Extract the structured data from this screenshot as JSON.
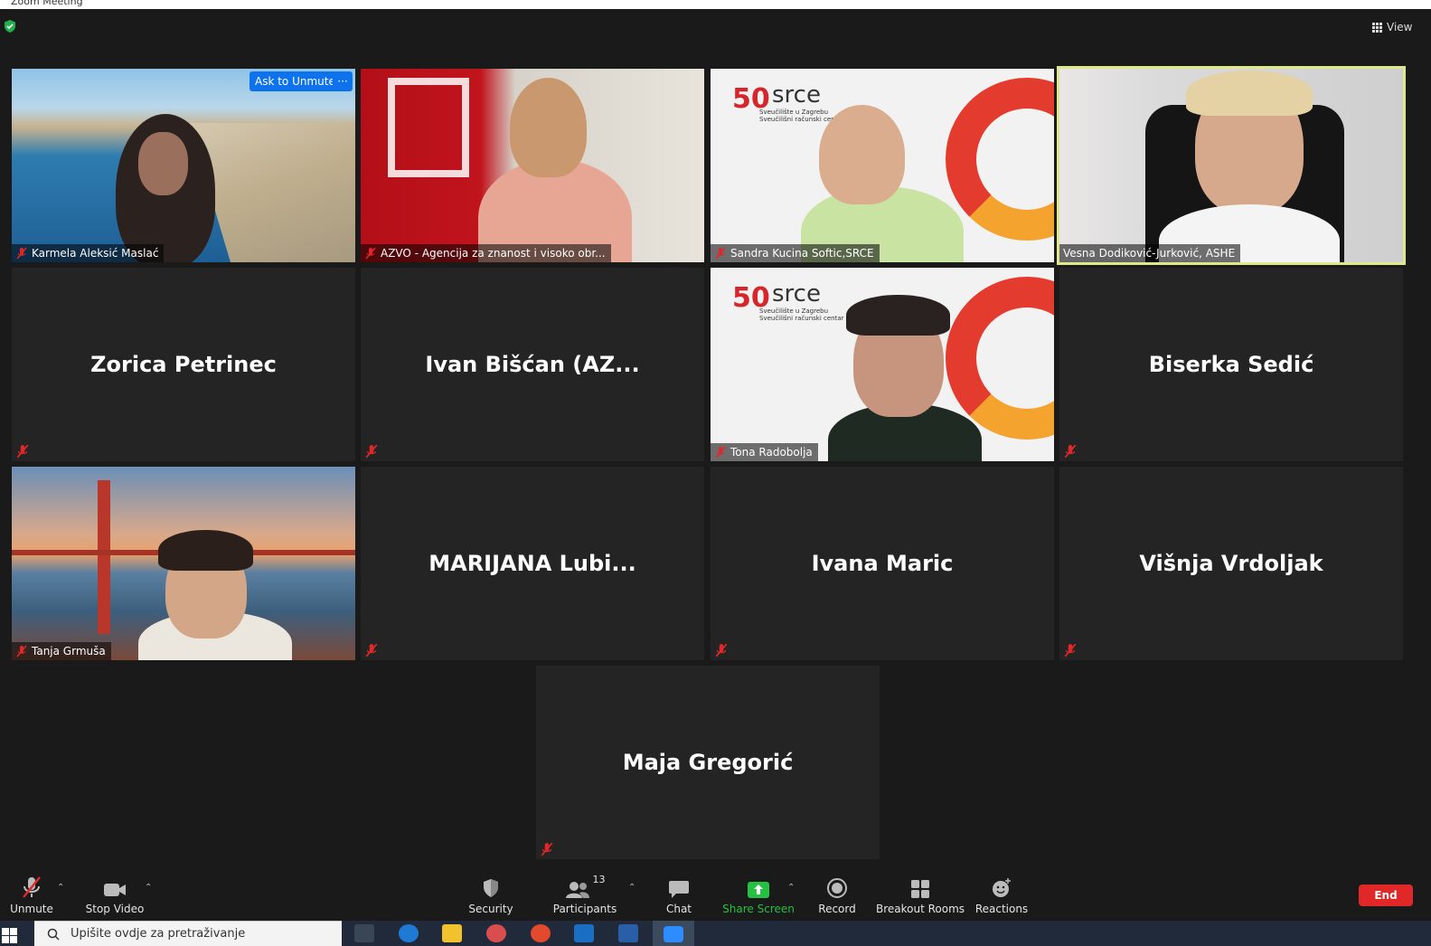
{
  "window": {
    "title": "Zoom Meeting"
  },
  "topbar": {
    "view_label": "View"
  },
  "tiles": [
    {
      "name": "Karmela Aleksić Maslać",
      "video": true,
      "ask_unmute": "Ask to Unmute",
      "more": "···"
    },
    {
      "name": "AZVO - Agencija za znanost i visoko obr...",
      "video": true
    },
    {
      "name": "Sandra Kucina Softic,SRCE",
      "video": true
    },
    {
      "name": "Vesna Dodiković-Jurković, ASHE",
      "video": true,
      "active_speaker": true
    },
    {
      "name": "Zorica Petrinec",
      "video": false
    },
    {
      "name": "Ivan  Bišćan  (AZ...",
      "video": false
    },
    {
      "name": "Tona Radobolja",
      "video": true
    },
    {
      "name": "Biserka Sedić",
      "video": false
    },
    {
      "name": "Tanja Grmuša",
      "video": true
    },
    {
      "name": "MARIJANA  Lubi...",
      "video": false
    },
    {
      "name": "Ivana Maric",
      "video": false
    },
    {
      "name": "Višnja Vrdoljak",
      "video": false
    },
    {
      "name": "Maja Gregorić",
      "video": false
    }
  ],
  "srce_logo": {
    "number": "50",
    "word": "srce",
    "sub1": "Sveučilište u Zagrebu",
    "sub2": "Sveučilišni računski centar"
  },
  "toolbar": {
    "unmute": "Unmute",
    "stop_video": "Stop Video",
    "security": "Security",
    "participants": "Participants",
    "participants_count": "13",
    "chat": "Chat",
    "share_screen": "Share Screen",
    "record": "Record",
    "breakout_rooms": "Breakout Rooms",
    "reactions": "Reactions",
    "end": "End"
  },
  "taskbar": {
    "search_placeholder": "Upišite ovdje za pretraživanje"
  },
  "colors": {
    "accent_blue": "#0e72ed",
    "end_red": "#e02828",
    "share_green": "#25c143",
    "active_border": "#dfe98b",
    "mute_red": "#e02828"
  }
}
